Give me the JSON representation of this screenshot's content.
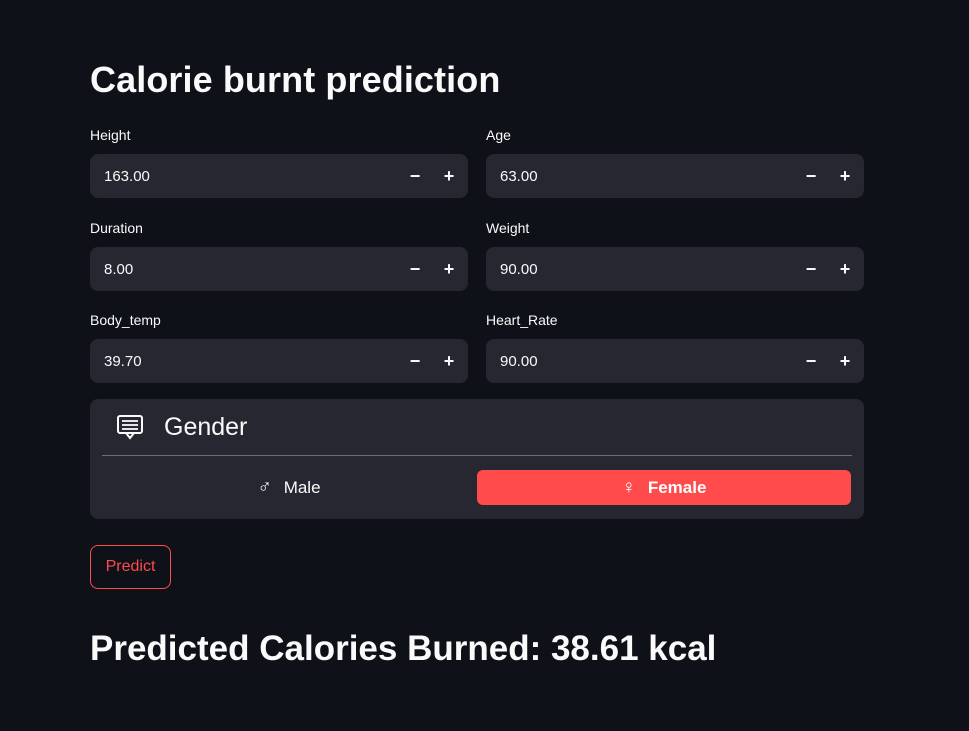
{
  "title": "Calorie burnt prediction",
  "fields": [
    {
      "label": "Height",
      "value": "163.00"
    },
    {
      "label": "Age",
      "value": "63.00"
    },
    {
      "label": "Duration",
      "value": "8.00"
    },
    {
      "label": "Weight",
      "value": "90.00"
    },
    {
      "label": "Body_temp",
      "value": "39.70"
    },
    {
      "label": "Heart_Rate",
      "value": "90.00"
    }
  ],
  "stepper": {
    "minus": "−",
    "plus": "+"
  },
  "gender": {
    "title": "Gender",
    "icon": "form-card-icon",
    "options": [
      {
        "label": "Male",
        "icon": "♂",
        "selected": false
      },
      {
        "label": "Female",
        "icon": "♀",
        "selected": true
      }
    ]
  },
  "predict_button": "Predict",
  "result": "Predicted Calories Burned: 38.61 kcal",
  "colors": {
    "background": "#0e1117",
    "surface": "#262730",
    "accent": "#ff4b4b",
    "text": "#fafafa"
  }
}
